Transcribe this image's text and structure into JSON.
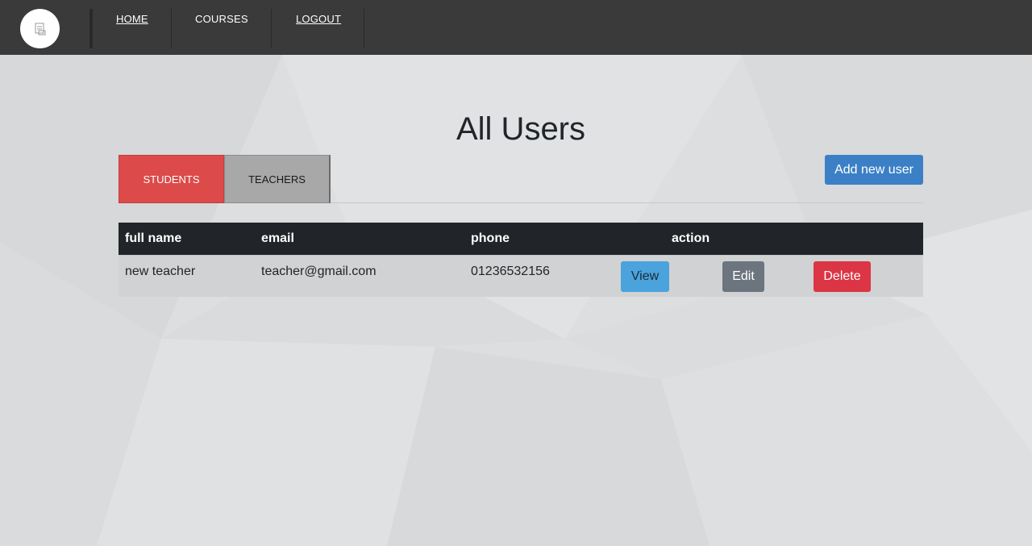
{
  "nav": {
    "home": "HOME",
    "courses": "COURSES",
    "logout": "LOGOUT"
  },
  "page": {
    "title": "All Users"
  },
  "tabs": [
    {
      "label": "STUDENTS",
      "active": true
    },
    {
      "label": "TEACHERS",
      "active": false
    }
  ],
  "add_button": "Add new user",
  "table": {
    "headers": [
      "full name",
      "email",
      "phone",
      "action"
    ],
    "rows": [
      {
        "full_name": "new teacher",
        "email": "teacher@gmail.com",
        "phone": "01236532156",
        "actions": [
          "View",
          "Edit",
          "Delete"
        ]
      }
    ]
  },
  "colors": {
    "navbar": "#3a3a3a",
    "tab_active": "#dc4a4a",
    "tab_inactive": "#a8a8a8",
    "primary": "#3b80c6",
    "view": "#4aa3dc",
    "edit": "#6c757d",
    "delete": "#dc3545",
    "table_header": "#212529"
  },
  "icons": {
    "logo": "document-logo-icon"
  }
}
